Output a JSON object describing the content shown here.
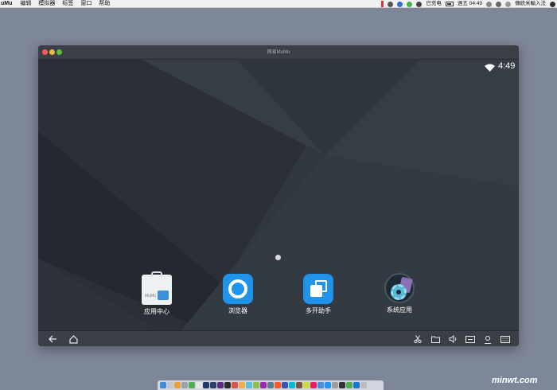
{
  "menubar": {
    "app_name": "uMu",
    "items": [
      "编辑",
      "模拟器",
      "标签",
      "窗口",
      "帮助"
    ],
    "charging_status": "已充电",
    "clock": "週五 04:49",
    "input_method": "傳統米輸入法"
  },
  "window": {
    "title": "网易MuMu"
  },
  "android": {
    "time": "4:49",
    "apps": [
      {
        "label": "应用中心",
        "icon": "app-center-icon"
      },
      {
        "label": "浏览器",
        "icon": "browser-icon"
      },
      {
        "label": "多开助手",
        "icon": "multi-open-icon"
      },
      {
        "label": "系统应用",
        "icon": "system-apps-icon"
      }
    ]
  },
  "colors": {
    "desktop": "#7e8797",
    "accent_blue": "#1f94ea",
    "navbar": "#3a3f46"
  },
  "watermark": "minwt.com"
}
